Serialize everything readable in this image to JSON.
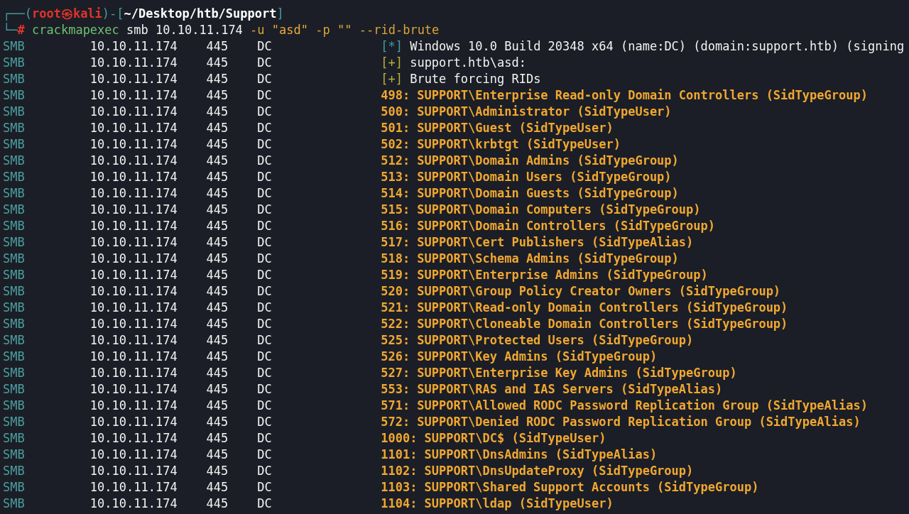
{
  "prompt": {
    "frame_open": "┌──(",
    "frame_mid": ")-[",
    "frame_close": "]",
    "frame_corner": "└─",
    "user": "root",
    "symbol": "㉿",
    "host": "kali",
    "path": "~/Desktop/htb/Support",
    "marker": "#",
    "command": [
      {
        "kind": "program",
        "text": "crackmapexec"
      },
      {
        "kind": "arg",
        "text": "smb"
      },
      {
        "kind": "arg",
        "text": "10.10.11.174"
      },
      {
        "kind": "option",
        "text": "-u"
      },
      {
        "kind": "string",
        "text": "\"asd\""
      },
      {
        "kind": "option",
        "text": "-p"
      },
      {
        "kind": "string",
        "text": "\"\""
      },
      {
        "kind": "option",
        "text": "--rid-brute"
      }
    ]
  },
  "rows": [
    {
      "protocol": "SMB",
      "host": "10.10.11.174",
      "port": "445",
      "name": "DC",
      "kind": "status",
      "marker": "[*]",
      "text": "Windows 10.0 Build 20348 x64 (name:DC) (domain:support.htb) (signing"
    },
    {
      "protocol": "SMB",
      "host": "10.10.11.174",
      "port": "445",
      "name": "DC",
      "kind": "success",
      "marker": "[+]",
      "text": "support.htb\\asd:"
    },
    {
      "protocol": "SMB",
      "host": "10.10.11.174",
      "port": "445",
      "name": "DC",
      "kind": "success",
      "marker": "[+]",
      "text": "Brute forcing RIDs"
    },
    {
      "protocol": "SMB",
      "host": "10.10.11.174",
      "port": "445",
      "name": "DC",
      "kind": "found",
      "text": "498: SUPPORT\\Enterprise Read-only Domain Controllers (SidTypeGroup)"
    },
    {
      "protocol": "SMB",
      "host": "10.10.11.174",
      "port": "445",
      "name": "DC",
      "kind": "found",
      "text": "500: SUPPORT\\Administrator (SidTypeUser)"
    },
    {
      "protocol": "SMB",
      "host": "10.10.11.174",
      "port": "445",
      "name": "DC",
      "kind": "found",
      "text": "501: SUPPORT\\Guest (SidTypeUser)"
    },
    {
      "protocol": "SMB",
      "host": "10.10.11.174",
      "port": "445",
      "name": "DC",
      "kind": "found",
      "text": "502: SUPPORT\\krbtgt (SidTypeUser)"
    },
    {
      "protocol": "SMB",
      "host": "10.10.11.174",
      "port": "445",
      "name": "DC",
      "kind": "found",
      "text": "512: SUPPORT\\Domain Admins (SidTypeGroup)"
    },
    {
      "protocol": "SMB",
      "host": "10.10.11.174",
      "port": "445",
      "name": "DC",
      "kind": "found",
      "text": "513: SUPPORT\\Domain Users (SidTypeGroup)"
    },
    {
      "protocol": "SMB",
      "host": "10.10.11.174",
      "port": "445",
      "name": "DC",
      "kind": "found",
      "text": "514: SUPPORT\\Domain Guests (SidTypeGroup)"
    },
    {
      "protocol": "SMB",
      "host": "10.10.11.174",
      "port": "445",
      "name": "DC",
      "kind": "found",
      "text": "515: SUPPORT\\Domain Computers (SidTypeGroup)"
    },
    {
      "protocol": "SMB",
      "host": "10.10.11.174",
      "port": "445",
      "name": "DC",
      "kind": "found",
      "text": "516: SUPPORT\\Domain Controllers (SidTypeGroup)"
    },
    {
      "protocol": "SMB",
      "host": "10.10.11.174",
      "port": "445",
      "name": "DC",
      "kind": "found",
      "text": "517: SUPPORT\\Cert Publishers (SidTypeAlias)"
    },
    {
      "protocol": "SMB",
      "host": "10.10.11.174",
      "port": "445",
      "name": "DC",
      "kind": "found",
      "text": "518: SUPPORT\\Schema Admins (SidTypeGroup)"
    },
    {
      "protocol": "SMB",
      "host": "10.10.11.174",
      "port": "445",
      "name": "DC",
      "kind": "found",
      "text": "519: SUPPORT\\Enterprise Admins (SidTypeGroup)"
    },
    {
      "protocol": "SMB",
      "host": "10.10.11.174",
      "port": "445",
      "name": "DC",
      "kind": "found",
      "text": "520: SUPPORT\\Group Policy Creator Owners (SidTypeGroup)"
    },
    {
      "protocol": "SMB",
      "host": "10.10.11.174",
      "port": "445",
      "name": "DC",
      "kind": "found",
      "text": "521: SUPPORT\\Read-only Domain Controllers (SidTypeGroup)"
    },
    {
      "protocol": "SMB",
      "host": "10.10.11.174",
      "port": "445",
      "name": "DC",
      "kind": "found",
      "text": "522: SUPPORT\\Cloneable Domain Controllers (SidTypeGroup)"
    },
    {
      "protocol": "SMB",
      "host": "10.10.11.174",
      "port": "445",
      "name": "DC",
      "kind": "found",
      "text": "525: SUPPORT\\Protected Users (SidTypeGroup)"
    },
    {
      "protocol": "SMB",
      "host": "10.10.11.174",
      "port": "445",
      "name": "DC",
      "kind": "found",
      "text": "526: SUPPORT\\Key Admins (SidTypeGroup)"
    },
    {
      "protocol": "SMB",
      "host": "10.10.11.174",
      "port": "445",
      "name": "DC",
      "kind": "found",
      "text": "527: SUPPORT\\Enterprise Key Admins (SidTypeGroup)"
    },
    {
      "protocol": "SMB",
      "host": "10.10.11.174",
      "port": "445",
      "name": "DC",
      "kind": "found",
      "text": "553: SUPPORT\\RAS and IAS Servers (SidTypeAlias)"
    },
    {
      "protocol": "SMB",
      "host": "10.10.11.174",
      "port": "445",
      "name": "DC",
      "kind": "found",
      "text": "571: SUPPORT\\Allowed RODC Password Replication Group (SidTypeAlias)"
    },
    {
      "protocol": "SMB",
      "host": "10.10.11.174",
      "port": "445",
      "name": "DC",
      "kind": "found",
      "text": "572: SUPPORT\\Denied RODC Password Replication Group (SidTypeAlias)"
    },
    {
      "protocol": "SMB",
      "host": "10.10.11.174",
      "port": "445",
      "name": "DC",
      "kind": "found",
      "text": "1000: SUPPORT\\DC$ (SidTypeUser)"
    },
    {
      "protocol": "SMB",
      "host": "10.10.11.174",
      "port": "445",
      "name": "DC",
      "kind": "found",
      "text": "1101: SUPPORT\\DnsAdmins (SidTypeAlias)"
    },
    {
      "protocol": "SMB",
      "host": "10.10.11.174",
      "port": "445",
      "name": "DC",
      "kind": "found",
      "text": "1102: SUPPORT\\DnsUpdateProxy (SidTypeGroup)"
    },
    {
      "protocol": "SMB",
      "host": "10.10.11.174",
      "port": "445",
      "name": "DC",
      "kind": "found",
      "text": "1103: SUPPORT\\Shared Support Accounts (SidTypeGroup)"
    },
    {
      "protocol": "SMB",
      "host": "10.10.11.174",
      "port": "445",
      "name": "DC",
      "kind": "found",
      "text": "1104: SUPPORT\\ldap (SidTypeUser)"
    }
  ]
}
